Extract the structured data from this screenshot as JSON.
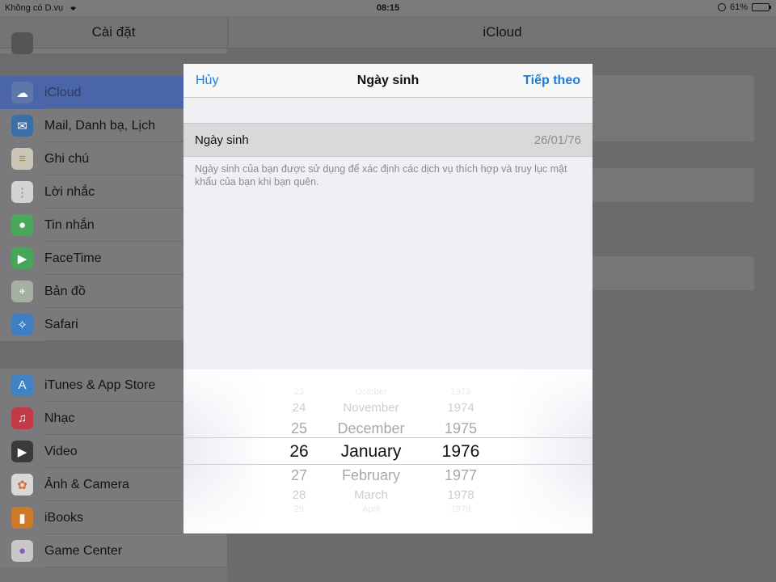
{
  "status": {
    "carrier": "Không có D.vụ",
    "time": "08:15",
    "battery": "61%",
    "battery_level": 0.61
  },
  "sidebar": {
    "title": "Cài đặt",
    "group1": [
      {
        "label": "iCloud",
        "icon": "cloud-icon",
        "glyph": "☁",
        "color": "c-icloud",
        "selected": true
      },
      {
        "label": "Mail, Danh bạ, Lịch",
        "icon": "mail-icon",
        "glyph": "✉",
        "color": "c-mail"
      },
      {
        "label": "Ghi chú",
        "icon": "notes-icon",
        "glyph": "≡",
        "color": "c-notes"
      },
      {
        "label": "Lời nhắc",
        "icon": "reminders-icon",
        "glyph": "⋮",
        "color": "c-remind"
      },
      {
        "label": "Tin nhắn",
        "icon": "messages-icon",
        "glyph": "●",
        "color": "c-msg"
      },
      {
        "label": "FaceTime",
        "icon": "facetime-icon",
        "glyph": "▶",
        "color": "c-face"
      },
      {
        "label": "Bản đồ",
        "icon": "maps-icon",
        "glyph": "⌖",
        "color": "c-maps"
      },
      {
        "label": "Safari",
        "icon": "safari-icon",
        "glyph": "✧",
        "color": "c-safari"
      }
    ],
    "group2": [
      {
        "label": "iTunes & App Store",
        "icon": "app-store-icon",
        "glyph": "A",
        "color": "c-itunes"
      },
      {
        "label": "Nhạc",
        "icon": "music-icon",
        "glyph": "♫",
        "color": "c-music"
      },
      {
        "label": "Video",
        "icon": "video-icon",
        "glyph": "▶",
        "color": "c-video"
      },
      {
        "label": "Ảnh & Camera",
        "icon": "photos-icon",
        "glyph": "✿",
        "color": "c-photos"
      },
      {
        "label": "iBooks",
        "icon": "ibooks-icon",
        "glyph": "▮",
        "color": "c-ibooks"
      },
      {
        "label": "Game Center",
        "icon": "game-center-icon",
        "glyph": "●",
        "color": "c-game"
      }
    ]
  },
  "main": {
    "title": "iCloud"
  },
  "modal": {
    "cancel": "Hủy",
    "title": "Ngày sinh",
    "next": "Tiếp theo",
    "row_label": "Ngày sinh",
    "row_value": "26/01/76",
    "footnote": "Ngày sinh của bạn được sử dụng để xác định các dịch vụ thích hợp và truy lục mật khẩu của bạn khi bạn quên."
  },
  "picker": {
    "days": [
      "23",
      "24",
      "25",
      "26",
      "27",
      "28",
      "29"
    ],
    "months": [
      "October",
      "November",
      "December",
      "January",
      "February",
      "March",
      "April"
    ],
    "years": [
      "1973",
      "1974",
      "1975",
      "1976",
      "1977",
      "1978",
      "1979"
    ],
    "selected_index": 3
  }
}
